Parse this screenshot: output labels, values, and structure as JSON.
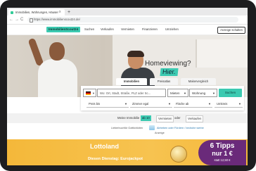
{
  "browser": {
    "tab_title": "Immobilien, Wohnungen, Häuser",
    "tab_close": "x",
    "new_tab": "+",
    "back": "←",
    "forward": "→",
    "reload": "C",
    "url": "https://www.immobilienscout24.de/"
  },
  "site": {
    "logo": "ImmobilienScout24",
    "nav": [
      "Suchen",
      "Verkaufen",
      "Vermieten",
      "Finanzieren",
      "Umziehen"
    ],
    "cta": "Anzeige schalten"
  },
  "hero": {
    "headline": "Homeviewing?",
    "badge": "Hier."
  },
  "search": {
    "tabs": [
      "Immobilien",
      "Preisatlas",
      "Makervergleich"
    ],
    "country_placeholder": "▼",
    "where_placeholder": "Wo: Ort, Stadt, Straße, PLZ oder Sc...",
    "offer_type": "Mieten",
    "property_type": "Wohnung",
    "submit": "Suchen",
    "filters": [
      "Preis bis",
      "Zimmer egal",
      "Fläche ab",
      "Umkreis"
    ]
  },
  "actions": {
    "label": "Meine Immobilie",
    "tag": "ab 10",
    "rent": "Vermieten",
    "or": "oder",
    "sell": "Verkaufen"
  },
  "info": {
    "text": "Lieberbuchfür Gottlichkiten",
    "link": "Abheben oder Fördern / bedrohe werbe",
    "sub": "Anzeige"
  },
  "ad": {
    "logo": "Lottoland",
    "line": "Diesen Dienstag: Eurojackpot",
    "promo_1": "6 Tipps",
    "promo_2": "nur 1 €",
    "promo_3": "statt 12,50 €"
  }
}
